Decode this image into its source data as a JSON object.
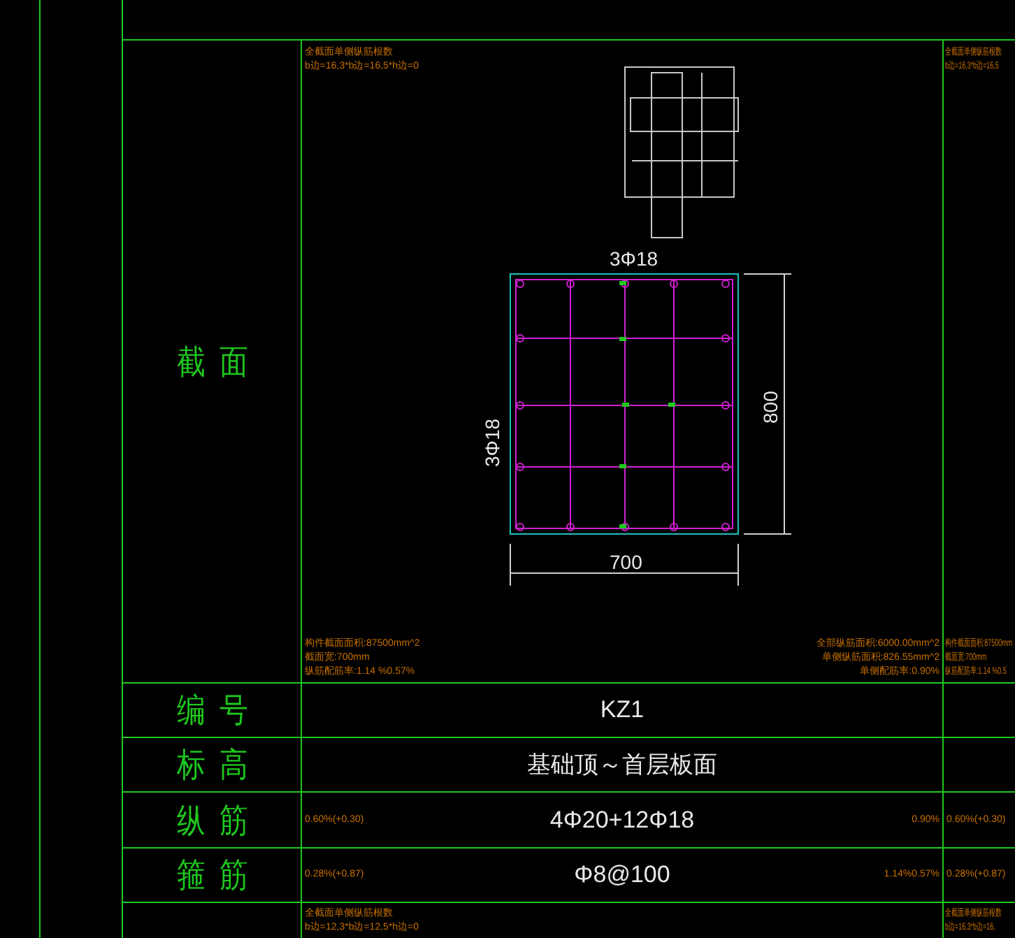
{
  "section_row": {
    "label": "截面",
    "notes_top": [
      "全截面单侧纵筋根数",
      "b边=16,3*b边=16,5*h边=0"
    ],
    "notes_bottom_left": [
      "构件截面面积:87500mm^2",
      "截面宽:700mm",
      "纵筋配筋率:1.14 %0.57%"
    ],
    "notes_bottom_right": [
      "全部纵筋面积:6000.00mm^2",
      "单侧纵筋面积:826.55mm^2",
      "单侧配筋率:0.90%"
    ],
    "drawing": {
      "top_label": "3Φ18",
      "side_label": "3Φ18",
      "width_label": "700",
      "height_label": "800"
    },
    "next_column_notes_top": [
      "全截面单侧纵筋根数",
      "b边=16,3*b边=16,5"
    ],
    "next_column_notes_bottom": [
      "构件截面面积:87500mm",
      "截面宽:700mm",
      "纵筋配筋率:1.14 %0.5"
    ]
  },
  "rows": [
    {
      "label": "编号",
      "value": "KZ1"
    },
    {
      "label": "标高",
      "value": "基础顶～首层板面"
    },
    {
      "label": "纵筋",
      "value": "4Φ20+12Φ18",
      "left_note": "0.60%(+0.30)",
      "right_note": "0.90%",
      "next_column_note": "0.60%(+0.30)"
    },
    {
      "label": "箍筋",
      "value": "Φ8@100",
      "left_note": "0.28%(+0.87)",
      "right_note": "1.14%0.57%",
      "next_column_note": "0.28%(+0.87)"
    }
  ],
  "last_row": {
    "notes": [
      "全截面单侧纵筋根数",
      "b边=12,3*b边=12,5*h边=0"
    ],
    "next_column_notes": [
      "全截面单侧纵筋根数",
      "b边=16,3*b边=16,"
    ]
  }
}
